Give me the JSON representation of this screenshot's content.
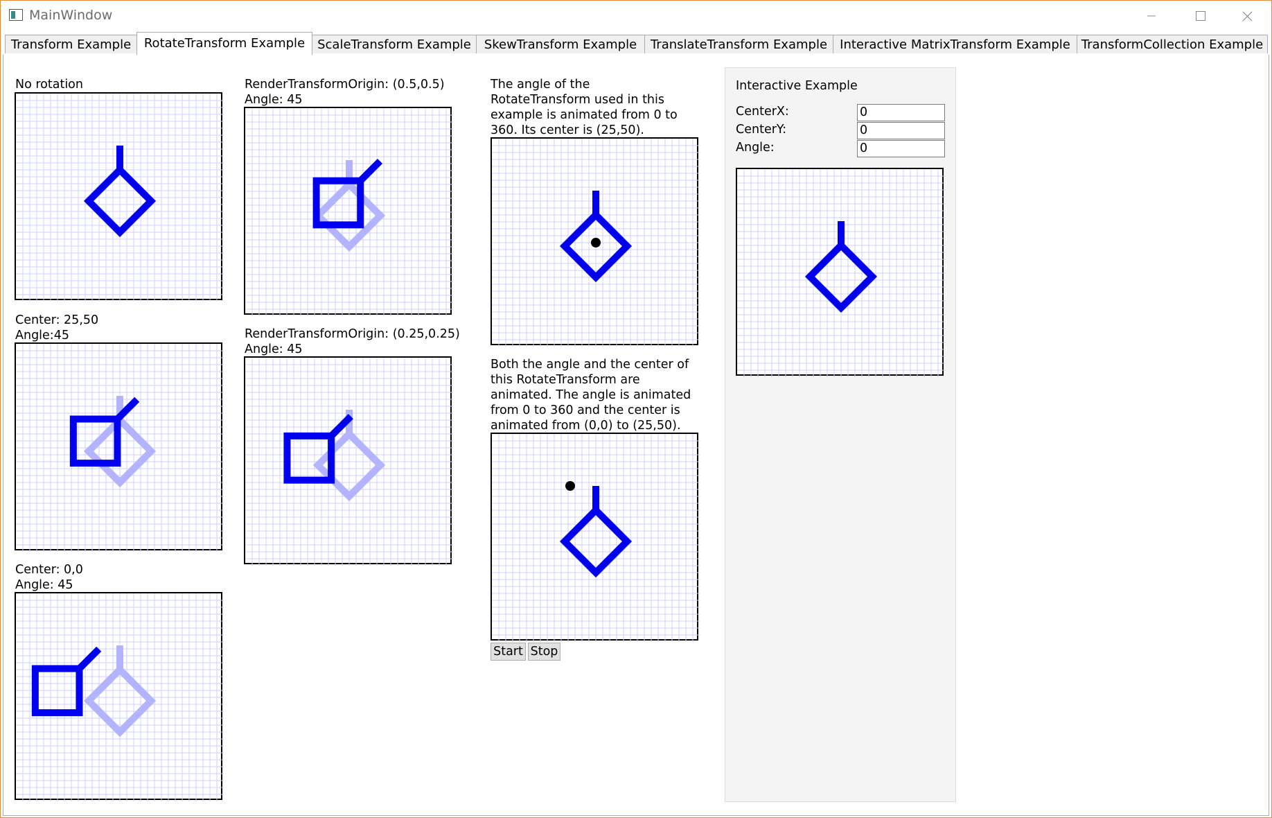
{
  "window": {
    "title": "MainWindow",
    "border_color": "#e08a3c"
  },
  "tabs": [
    {
      "label": "Transform Example"
    },
    {
      "label": "RotateTransform Example",
      "selected": true
    },
    {
      "label": "ScaleTransform Example"
    },
    {
      "label": "SkewTransform Example"
    },
    {
      "label": "TranslateTransform Example"
    },
    {
      "label": "Interactive MatrixTransform Example"
    },
    {
      "label": "TransformCollection Example"
    }
  ],
  "examples": {
    "no_rotation": {
      "label": "No rotation"
    },
    "center_25_50": {
      "line1": "Center: 25,50",
      "line2": "Angle:45"
    },
    "center_0_0": {
      "line1": "Center: 0,0",
      "line2": "Angle: 45"
    },
    "origin_05": {
      "line1": "RenderTransformOrigin: (0.5,0.5)",
      "line2": "Angle: 45"
    },
    "origin_025": {
      "line1": "RenderTransformOrigin: (0.25,0.25)",
      "line2": "Angle: 45"
    },
    "animated_angle": {
      "lines": [
        "The angle of the",
        "RotateTransform used in this",
        "example is animated from 0 to",
        "360. Its center is (25,50)."
      ]
    },
    "animated_both": {
      "lines": [
        "Both the angle and the center of",
        "this RotateTransform are",
        "animated. The angle is animated",
        "from 0 to 360 and the center is",
        "animated from (0,0) to (25,50)."
      ],
      "start_label": "Start",
      "stop_label": "Stop"
    }
  },
  "interactive": {
    "title": "Interactive Example",
    "centerx_label": "CenterX:",
    "centerx_value": "0",
    "centery_label": "CenterY:",
    "centery_value": "0",
    "angle_label": "Angle:",
    "angle_value": "0"
  },
  "colors": {
    "shape": "#0000ee",
    "shape_ghost": "#b3b3ff",
    "grid_line": "#cfcfff",
    "panel_bg": "#f4f4f4"
  }
}
